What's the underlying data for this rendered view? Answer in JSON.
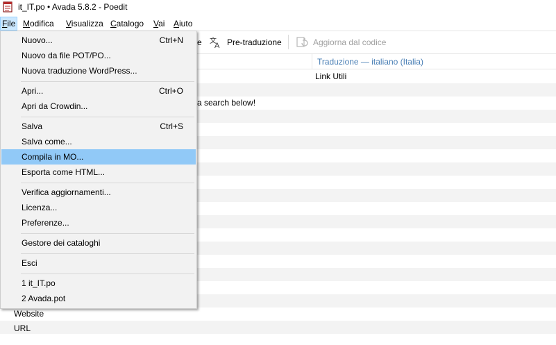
{
  "window": {
    "title": "it_IT.po • Avada 5.8.2 - Poedit"
  },
  "menubar": {
    "items": [
      {
        "label": "File",
        "ul": "F",
        "rest": "ile"
      },
      {
        "label": "Modifica",
        "ul": "M",
        "rest": "odifica"
      },
      {
        "label": "Visualizza",
        "ul": "V",
        "rest": "isualizza"
      },
      {
        "label": "Catalogo",
        "ul": "C",
        "rest": "atalogo"
      },
      {
        "label": "Vai",
        "ul": "V",
        "rest": "ai"
      },
      {
        "label": "Aiuto",
        "ul": "A",
        "rest": "iuto"
      }
    ]
  },
  "toolbar": {
    "partial_label": "e",
    "pretranslate_label": "Pre-traduzione",
    "update_label": "Aggiorna dal codice"
  },
  "list": {
    "columns": {
      "translation": "Traduzione — italiano (Italia)"
    },
    "visible_fragments": {
      "row1_translation": "Link Utili",
      "row3_source_tail": "a search below!",
      "row_website_source": "Website",
      "row_url_partial": "URL"
    }
  },
  "file_menu": {
    "items": [
      {
        "label": "Nuovo...",
        "shortcut": "Ctrl+N"
      },
      {
        "label": "Nuovo da file POT/PO...",
        "shortcut": ""
      },
      {
        "label": "Nuova traduzione WordPress...",
        "shortcut": ""
      },
      {
        "label": "Apri...",
        "shortcut": "Ctrl+O"
      },
      {
        "label": "Apri da Crowdin...",
        "shortcut": ""
      },
      {
        "label": "Salva",
        "shortcut": "Ctrl+S"
      },
      {
        "label": "Salva come...",
        "shortcut": ""
      },
      {
        "label": "Compila in MO...",
        "shortcut": "",
        "highlighted": true
      },
      {
        "label": "Esporta come HTML...",
        "shortcut": ""
      },
      {
        "label": "Verifica aggiornamenti...",
        "shortcut": ""
      },
      {
        "label": "Licenza...",
        "shortcut": ""
      },
      {
        "label": "Preferenze...",
        "shortcut": ""
      },
      {
        "label": "Gestore dei cataloghi",
        "shortcut": ""
      },
      {
        "label": "Esci",
        "shortcut": ""
      },
      {
        "label": "1 it_IT.po",
        "shortcut": ""
      },
      {
        "label": "2 Avada.pot",
        "shortcut": ""
      }
    ]
  },
  "colors": {
    "menu_highlight": "#91c9f7",
    "active_menu_bg": "#cce8ff",
    "column_header_text": "#4a7fb5",
    "row_alt": "#f3f3f3",
    "disabled_text": "#a0a0a0"
  },
  "icons": {
    "app": "poedit-app-icon",
    "pretranslate": "translate-icon",
    "update": "update-from-source-icon"
  }
}
